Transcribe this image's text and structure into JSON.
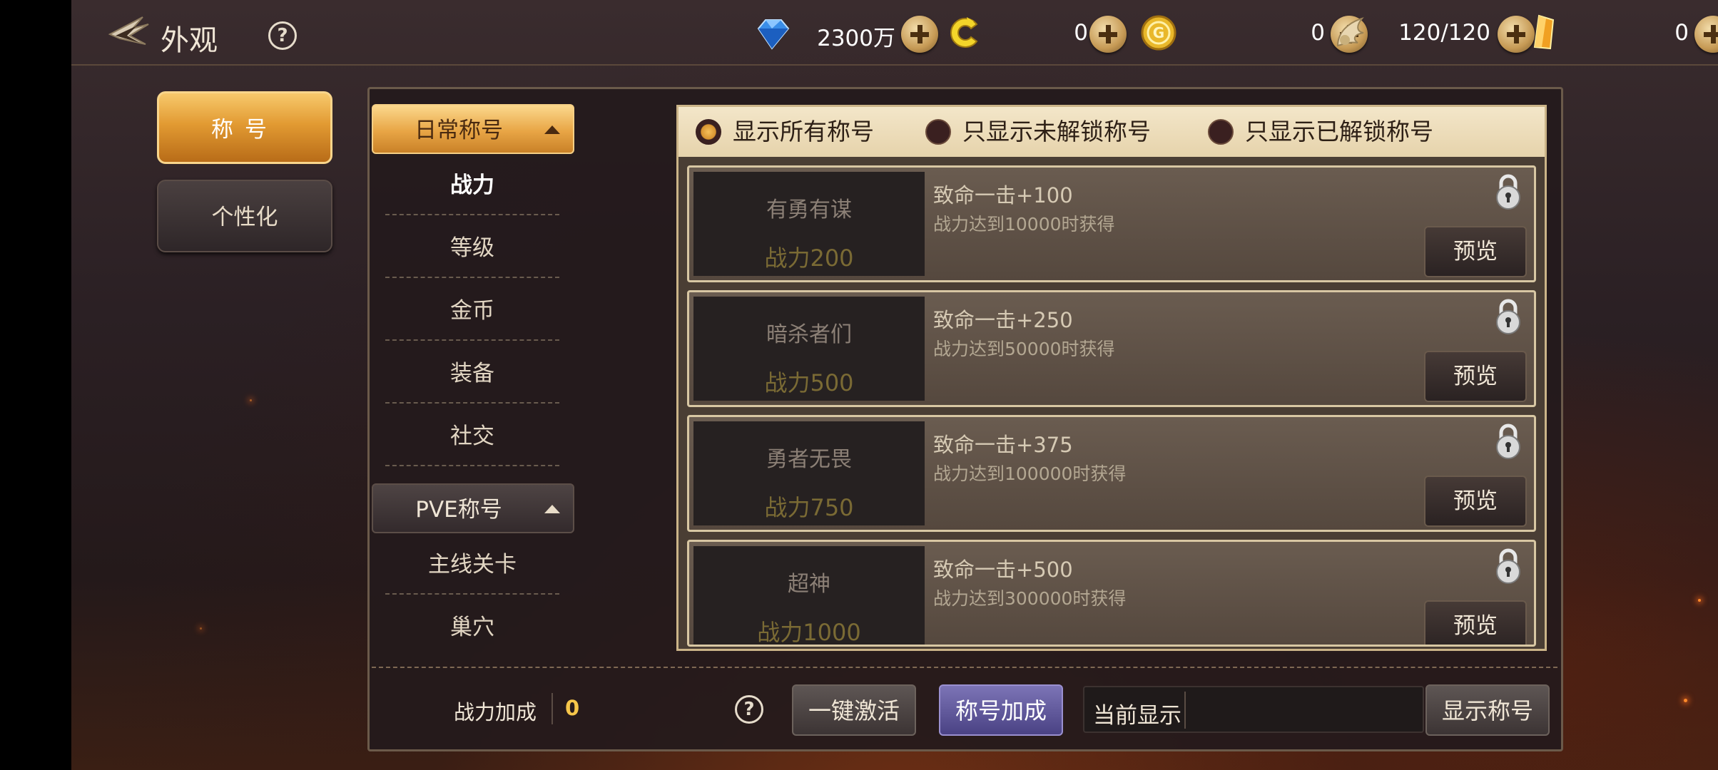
{
  "header": {
    "title": "外观",
    "help_icon": "?"
  },
  "resources": [
    {
      "name": "diamond",
      "icon": "blue-diamond-icon",
      "value": "2300万"
    },
    {
      "name": "c-coin",
      "icon": "c-coin-icon",
      "value": "0"
    },
    {
      "name": "gold",
      "icon": "gold-coin-icon",
      "value": "0"
    },
    {
      "name": "stamina",
      "icon": "wings-icon",
      "value": "120/120"
    },
    {
      "name": "crystal",
      "icon": "orange-crystal-icon",
      "value": "0"
    }
  ],
  "nav": {
    "title_tab": "称号",
    "custom_tab": "个性化"
  },
  "categories": {
    "daily": {
      "label": "日常称号",
      "items": [
        "战力",
        "等级",
        "金币",
        "装备",
        "社交"
      ],
      "active": "战力"
    },
    "pve": {
      "label": "PVE称号",
      "items": [
        "主线关卡",
        "巢穴"
      ]
    }
  },
  "filters": {
    "all": "显示所有称号",
    "locked": "只显示未解锁称号",
    "unlocked": "只显示已解锁称号",
    "selected": "all"
  },
  "titles": [
    {
      "name": "有勇有谋",
      "power": "战力200",
      "bonus": "致命一击+100",
      "condition": "战力达到10000时获得",
      "preview": "预览"
    },
    {
      "name": "暗杀者们",
      "power": "战力500",
      "bonus": "致命一击+250",
      "condition": "战力达到50000时获得",
      "preview": "预览"
    },
    {
      "name": "勇者无畏",
      "power": "战力750",
      "bonus": "致命一击+375",
      "condition": "战力达到100000时获得",
      "preview": "预览"
    },
    {
      "name": "超神",
      "power": "战力1000",
      "bonus": "致命一击+500",
      "condition": "战力达到300000时获得",
      "preview": "预览"
    }
  ],
  "footer": {
    "power_label": "战力加成",
    "power_value": "0",
    "help_icon": "?",
    "activate_all": "一键激活",
    "title_bonus": "称号加成",
    "current_label": "当前显示",
    "current_value": "",
    "show_title": "显示称号"
  },
  "colors": {
    "accent_gold": "#e29a32",
    "bonus_purple": "#5e56a0",
    "power_yellow": "#f6c64a"
  }
}
